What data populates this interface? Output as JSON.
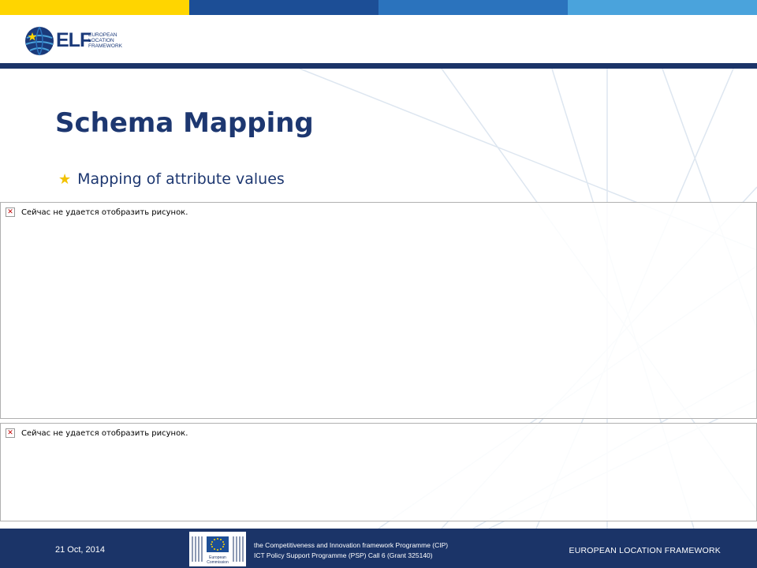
{
  "colors": {
    "top_bar": [
      "#ffd500",
      "#1c4e96",
      "#2b73bd",
      "#4aa3dc"
    ],
    "navy": "#1b3468",
    "title": "#1d3770",
    "bullet_star": "#f2c200"
  },
  "logo": {
    "text": "ELF",
    "subtitle_line1": "EUROPEAN",
    "subtitle_line2": "LOCATION",
    "subtitle_line3": "FRAMEWORK"
  },
  "slide": {
    "title": "Schema Mapping",
    "bullet": "Mapping of attribute values"
  },
  "placeholders": [
    {
      "message": "Сейчас не удается отобразить рисунок."
    },
    {
      "message": "Сейчас не удается отобразить рисунок."
    }
  ],
  "footer": {
    "date": "21 Oct, 2014",
    "ec_label_1": "European",
    "ec_label_2": "Commission",
    "program_line1": "the Competitiveness and Innovation framework Programme (CIP)",
    "program_line2": "ICT Policy Support Programme (PSP) Call 6 (Grant 325140)",
    "right_text": "EUROPEAN LOCATION FRAMEWORK"
  }
}
